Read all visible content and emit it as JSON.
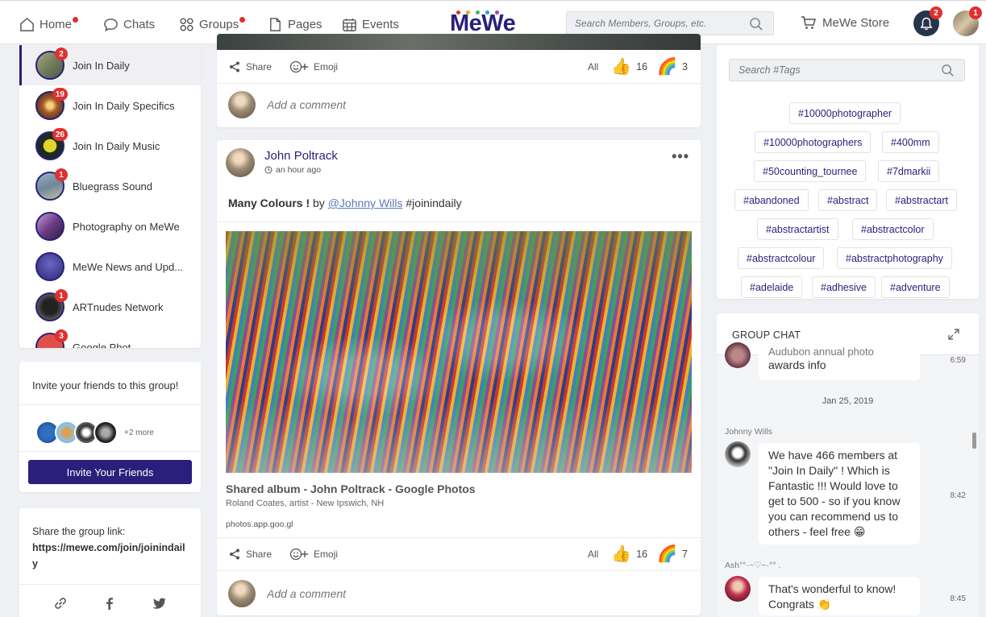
{
  "nav": {
    "home": "Home",
    "chats": "Chats",
    "groups": "Groups",
    "pages": "Pages",
    "events": "Events",
    "logo": "MeWe",
    "search_placeholder": "Search Members, Groups, etc.",
    "store": "MeWe Store",
    "notif_count": "2",
    "profile_count": "1"
  },
  "colors": {
    "brand": "#2a1f7a",
    "badge": "#e0302f"
  },
  "groups": [
    {
      "name": "Join In Daily",
      "badge": "2",
      "active": true
    },
    {
      "name": "Join In Daily Specifics",
      "badge": "19"
    },
    {
      "name": "Join In Daily Music",
      "badge": "26"
    },
    {
      "name": "Bluegrass Sound",
      "badge": "1"
    },
    {
      "name": "Photography on MeWe",
      "badge": ""
    },
    {
      "name": "MeWe News and Upd...",
      "badge": ""
    },
    {
      "name": "ARTnudes Network",
      "badge": "1"
    },
    {
      "name": "Google Phot...",
      "badge": "3"
    }
  ],
  "invite": {
    "title": "Invite your friends to this group!",
    "more": "+2 more",
    "button": "Invite Your Friends"
  },
  "share": {
    "label": "Share the group link:",
    "url": "https://mewe.com/join/joinindaily"
  },
  "post1": {
    "share": "Share",
    "emoji": "Emoji",
    "all": "All",
    "likes": "16",
    "rainbow": "3",
    "comment_placeholder": "Add a comment"
  },
  "post2": {
    "author": "John Poltrack",
    "time": "an hour ago",
    "text_bold": "Many Colours !",
    "text_by": " by ",
    "mention": "@Johnny Wills",
    "hashtag": " #joinindaily",
    "link_title": "Shared album - John Poltrack - Google Photos",
    "link_sub": "Roland Coates, artist - New Ipswich, NH",
    "link_domain": "photos.app.goo.gl",
    "share": "Share",
    "emoji": "Emoji",
    "all": "All",
    "likes": "16",
    "rainbow": "7",
    "comment_placeholder": "Add a comment"
  },
  "tags": {
    "search_placeholder": "Search #Tags",
    "items": [
      "#10000photographer",
      "#10000photographers",
      "#400mm",
      "#50counting_tournee",
      "#7dmarkii",
      "#abandoned",
      "#abstract",
      "#abstractart",
      "#abstractartist",
      "#abstractcolor",
      "#abstractcolour",
      "#abstractphotography",
      "#adelaide",
      "#adhesive",
      "#adventure"
    ]
  },
  "chat": {
    "title": "GROUP CHAT",
    "msg0_partial": "Audubon annual photo",
    "msg0": "awards info",
    "msg0_time": "6:59",
    "date": "Jan 25, 2019",
    "msg1_author": "Johnny Wills",
    "msg1": "We have 466 members at \"Join In Daily\" ! Which is Fantastic !!! Would love to get to 500 - so if you know you can recommend us to others - feel free",
    "msg1_time": "8:42",
    "msg2_author": "Ash°°·~♡~·°° .",
    "msg2": "That's wonderful to know! Congrats",
    "msg2_time": "8:45"
  }
}
